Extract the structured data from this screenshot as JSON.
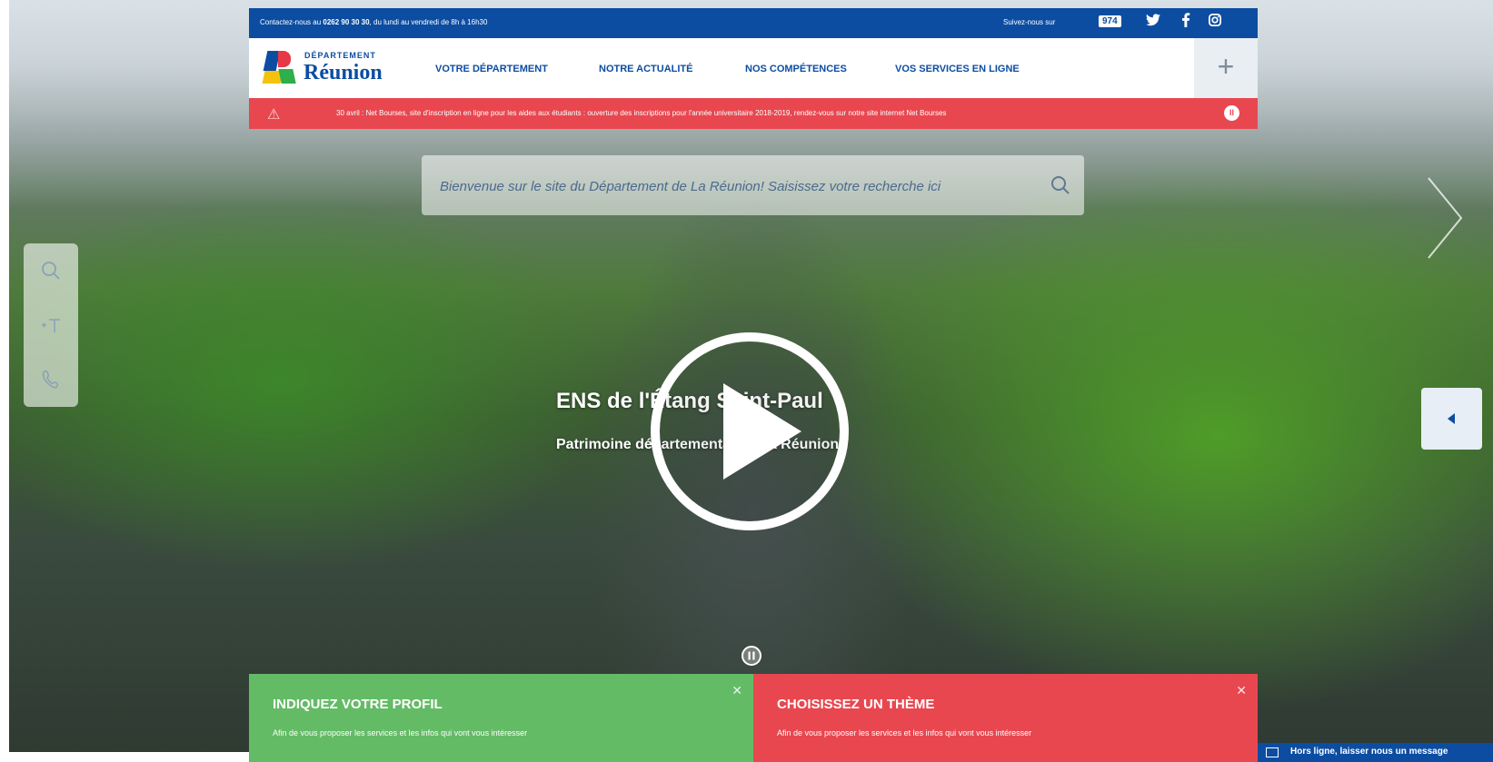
{
  "colors": {
    "brand_blue": "#0c4da2",
    "alert_red": "#e8474f",
    "profile_green": "#64bb66",
    "theme_red": "#e8474f"
  },
  "topbar": {
    "contact_prefix": "Contactez-nous au ",
    "contact_phone": "0262 90 30 30",
    "contact_suffix": ", du lundi au vendredi de 8h à 16h30",
    "follow_label": "Suivez-nous sur",
    "badge_974": "974",
    "social": [
      "974-icon",
      "twitter-icon",
      "facebook-icon",
      "instagram-icon"
    ]
  },
  "logo": {
    "line1": "DÉPARTEMENT",
    "line2": "Réunion"
  },
  "nav": {
    "items": [
      "VOTRE DÉPARTEMENT",
      "NOTRE ACTUALITÉ",
      "NOS COMPÉTENCES",
      "VOS SERVICES EN LIGNE"
    ],
    "plus": "+"
  },
  "alert": {
    "text": "30 avril : Net Bourses, site d'inscription en ligne pour les aides aux étudiants : ouverture des inscriptions pour l'année universitaire 2018-2019, rendez-vous sur notre site internet Net Bourses"
  },
  "search": {
    "placeholder": "Bienvenue sur le site du Département de La Réunion! Saisissez votre recherche ici"
  },
  "hero": {
    "title": "ENS de l'Étang Saint-Paul",
    "subtitle": "Patrimoine départemental de La Réunion"
  },
  "cards": {
    "profile": {
      "title": "INDIQUEZ VOTRE PROFIL",
      "desc": "Afin de vous proposer les services et les infos qui vont vous intéresser"
    },
    "theme": {
      "title": "CHOISISSEZ UN THÈME",
      "desc": "Afin de vous proposer les services et les infos qui vont vous intéresser"
    }
  },
  "chat": {
    "label": "Hors ligne, laisser nous un message"
  }
}
